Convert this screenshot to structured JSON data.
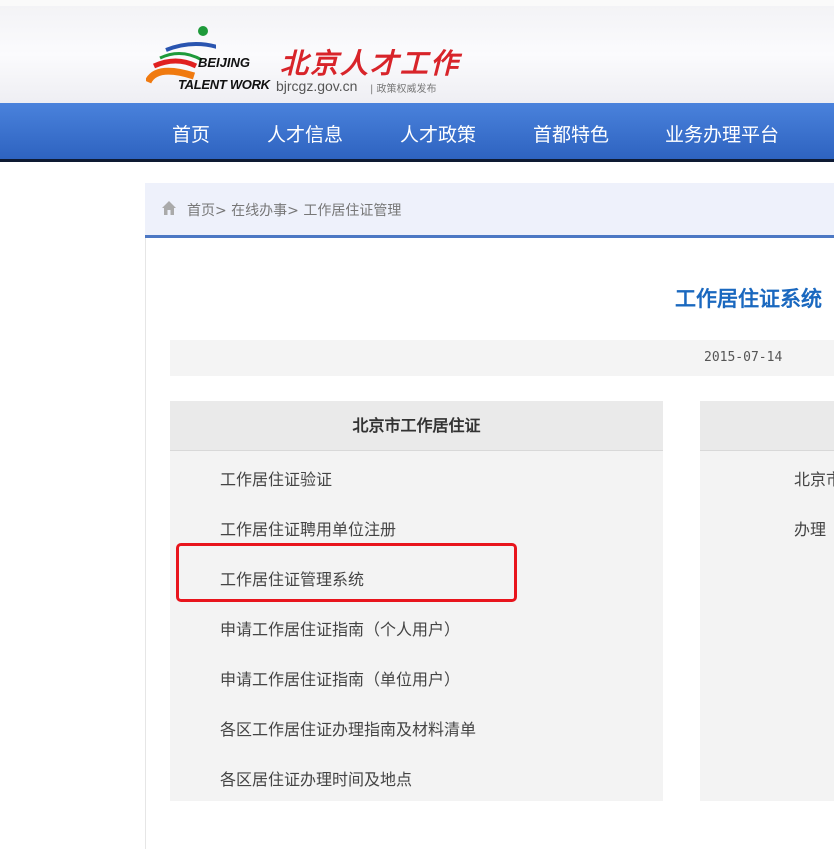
{
  "header": {
    "logo_en_line1": "BEIJING",
    "logo_en_line2": "TALENT WORK",
    "logo_cn": "北京人才工作",
    "url": "bjrcgz.gov.cn",
    "slogan": "| 政策权威发布"
  },
  "nav": [
    "首页",
    "人才信息",
    "人才政策",
    "首都特色",
    "业务办理平台"
  ],
  "breadcrumb": {
    "text": "首页> 在线办事> 工作居住证管理"
  },
  "page": {
    "title": "工作居住证系统",
    "date": "2015-07-14"
  },
  "left_panel": {
    "heading": "北京市工作居住证",
    "items": [
      "工作居住证验证",
      "工作居住证聘用单位注册",
      "工作居住证管理系统",
      "申请工作居住证指南（个人用户）",
      "申请工作居住证指南（单位用户）",
      "各区工作居住证办理指南及材料清单",
      "各区居住证办理时间及地点"
    ]
  },
  "right_panel": {
    "items": [
      "北京市",
      "办理"
    ]
  },
  "colors": {
    "nav": "#3a70cc",
    "title": "#1a68bf",
    "highlight": "#e8141c"
  }
}
